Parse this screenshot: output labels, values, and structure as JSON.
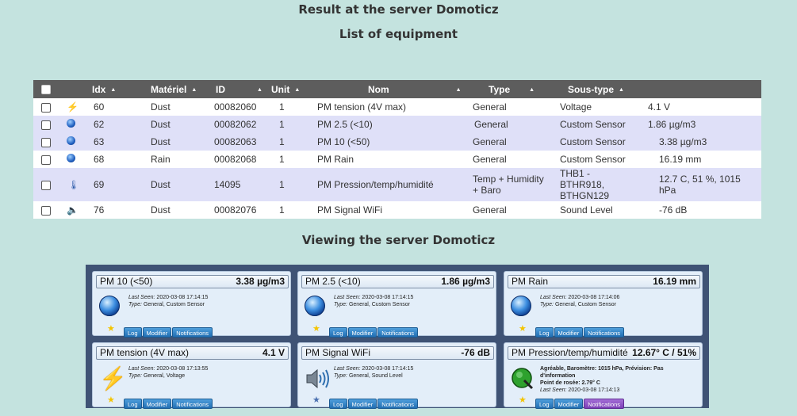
{
  "headings": {
    "server_result": "Result at the server Domoticz",
    "equipment_list": "List of equipment",
    "viewing": "Viewing the server Domoticz"
  },
  "table": {
    "columns": [
      "Idx",
      "Matériel",
      "ID",
      "Unit",
      "Nom",
      "Type",
      "Sous-type"
    ],
    "rows": [
      {
        "icon": "lightning-icon",
        "idx": "60",
        "materiel": "Dust",
        "id": "00082060",
        "unit": "1",
        "nom": "PM tension (4V max)",
        "type": "General",
        "soustype": "Voltage",
        "value": "4.1 V"
      },
      {
        "icon": "globe-icon",
        "idx": "62",
        "materiel": "Dust",
        "id": "00082062",
        "unit": "1",
        "nom": "PM 2.5 (<10)",
        "type": "General",
        "soustype": "Custom Sensor",
        "value": "1.86 µg/m3"
      },
      {
        "icon": "globe-icon",
        "idx": "63",
        "materiel": "Dust",
        "id": "00082063",
        "unit": "1",
        "nom": "PM 10 (<50)",
        "type": "General",
        "soustype": "Custom Sensor",
        "value": "3.38 µg/m3"
      },
      {
        "icon": "globe-icon",
        "idx": "68",
        "materiel": "Rain",
        "id": "00082068",
        "unit": "1",
        "nom": "PM Rain",
        "type": "General",
        "soustype": "Custom Sensor",
        "value": "16.19 mm"
      },
      {
        "icon": "thermometer-icon",
        "idx": "69",
        "materiel": "Dust",
        "id": "14095",
        "unit": "1",
        "nom": "PM Pression/temp/humidité",
        "type": "Temp + Humidity + Baro",
        "soustype": "THB1 - BTHR918, BTHGN129",
        "value": "12.7 C, 51 %, 1015 hPa"
      },
      {
        "icon": "speaker-icon",
        "idx": "76",
        "materiel": "Dust",
        "id": "00082076",
        "unit": "1",
        "nom": "PM Signal WiFi",
        "type": "General",
        "soustype": "Sound Level",
        "value": "-76 dB"
      }
    ]
  },
  "buttons": {
    "log": "Log",
    "modifier": "Modifier",
    "notifications": "Notifications"
  },
  "cards": [
    {
      "name": "PM 10 (<50)",
      "value": "3.38 µg/m3",
      "last_seen_label": "Last Seen:",
      "last_seen": "2020-03-08 17:14:15",
      "type_label": "Type:",
      "type": "General, Custom Sensor"
    },
    {
      "name": "PM 2.5 (<10)",
      "value": "1.86 µg/m3",
      "last_seen_label": "Last Seen:",
      "last_seen": "2020-03-08 17:14:15",
      "type_label": "Type:",
      "type": "General, Custom Sensor"
    },
    {
      "name": "PM Rain",
      "value": "16.19 mm",
      "last_seen_label": "Last Seen:",
      "last_seen": "2020-03-08 17:14:06",
      "type_label": "Type:",
      "type": "General, Custom Sensor"
    },
    {
      "name": "PM tension (4V max)",
      "value": "4.1 V",
      "last_seen_label": "Last Seen:",
      "last_seen": "2020-03-08 17:13:55",
      "type_label": "Type:",
      "type": "General, Voltage"
    },
    {
      "name": "PM Signal WiFi",
      "value": "-76 dB",
      "last_seen_label": "Last Seen:",
      "last_seen": "2020-03-08 17:14:15",
      "type_label": "Type:",
      "type": "General, Sound Level"
    },
    {
      "name": "PM Pression/temp/humidité",
      "value": "12.67° C / 51%",
      "forecast": "Agréable, Baromètre: 1015 hPa, Prévision: Pas d'information",
      "dewpoint": "Point de rosée: 2.79° C",
      "last_seen_label": "Last Seen:",
      "last_seen": "2020-03-08 17:14:13"
    }
  ],
  "colors": {
    "header_bg": "#5d5d5d",
    "row_alt": "#dfe0f8",
    "dashboard_bg": "#3f5375",
    "button": "#2a78bd",
    "notifications_alert": "#8d4fc6"
  }
}
